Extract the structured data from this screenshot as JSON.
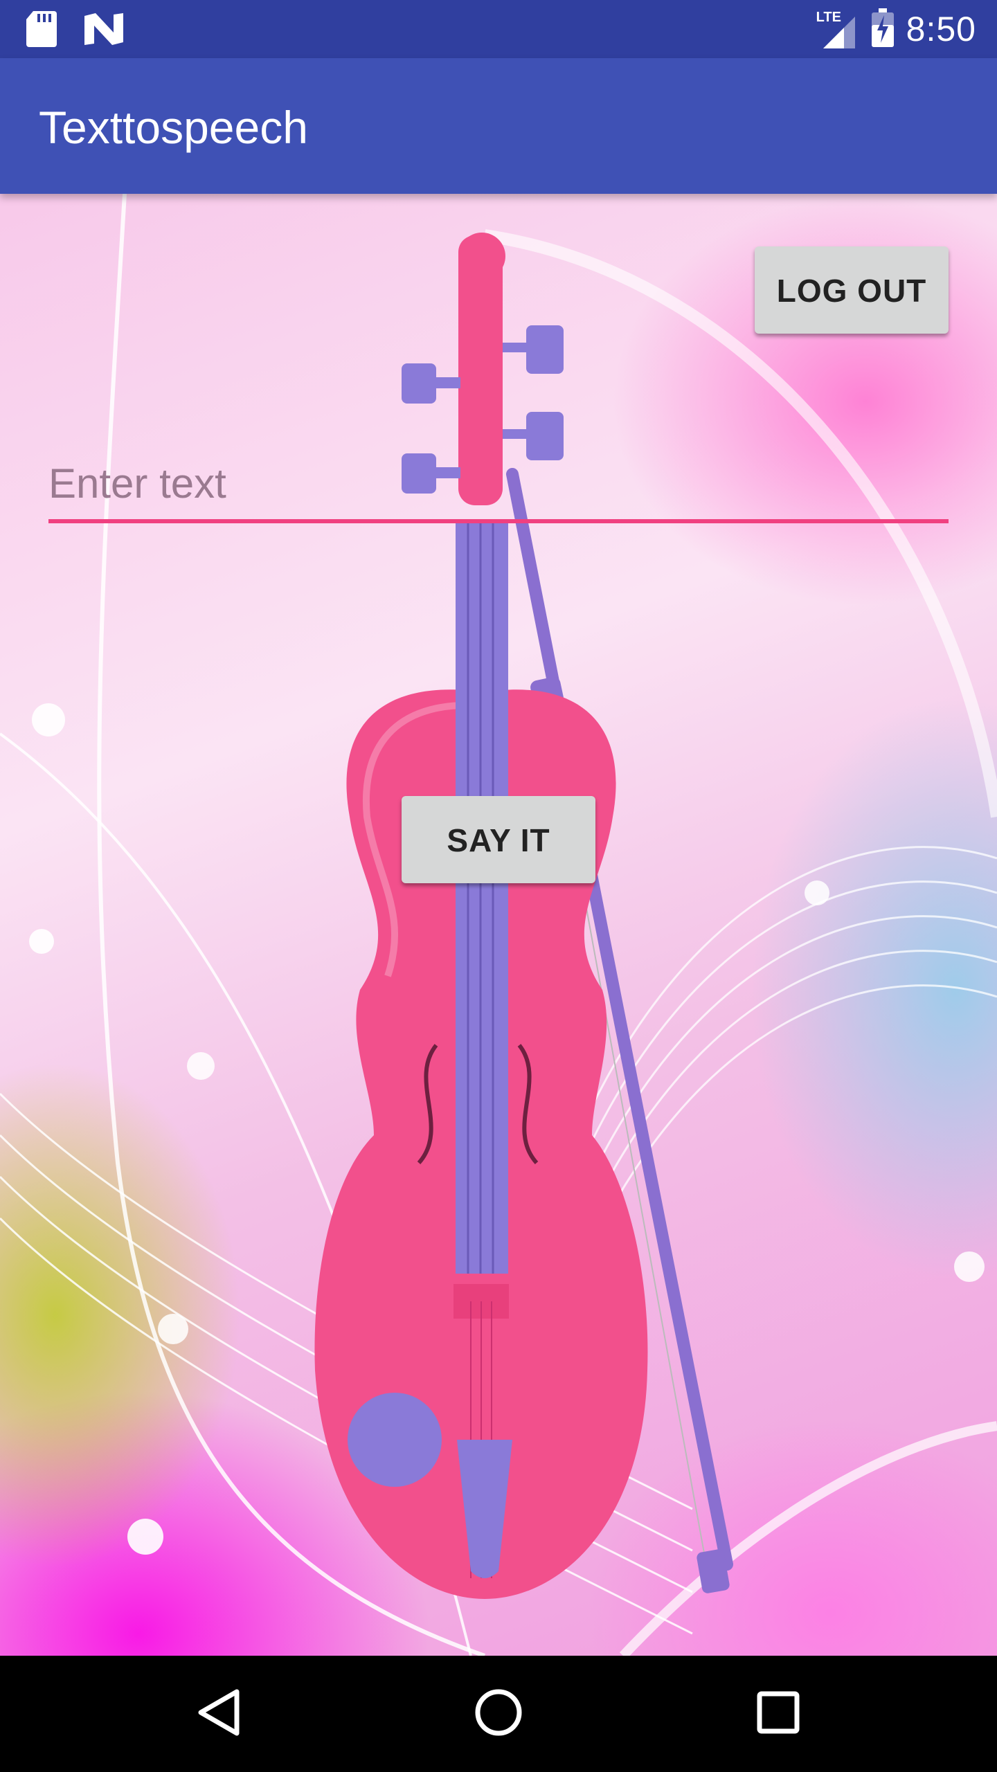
{
  "status_bar": {
    "time": "8:50",
    "network_label": "LTE",
    "icons": [
      "sd-card-icon",
      "n-logo-icon",
      "lte-signal-icon",
      "battery-icon"
    ]
  },
  "app_bar": {
    "title": "Texttospeech",
    "color": "#3F51B5",
    "status_color": "#303F9F"
  },
  "main": {
    "logout_label": "LOG OUT",
    "text_input": {
      "placeholder": "Enter text",
      "value": ""
    },
    "say_label": "SAY IT",
    "background_image": "pink-violin-with-bow"
  },
  "nav_bar": {
    "icons": [
      "back-icon",
      "home-icon",
      "recents-icon"
    ]
  },
  "colors": {
    "accent": "#F04080",
    "button_bg": "#D6D7D7"
  }
}
